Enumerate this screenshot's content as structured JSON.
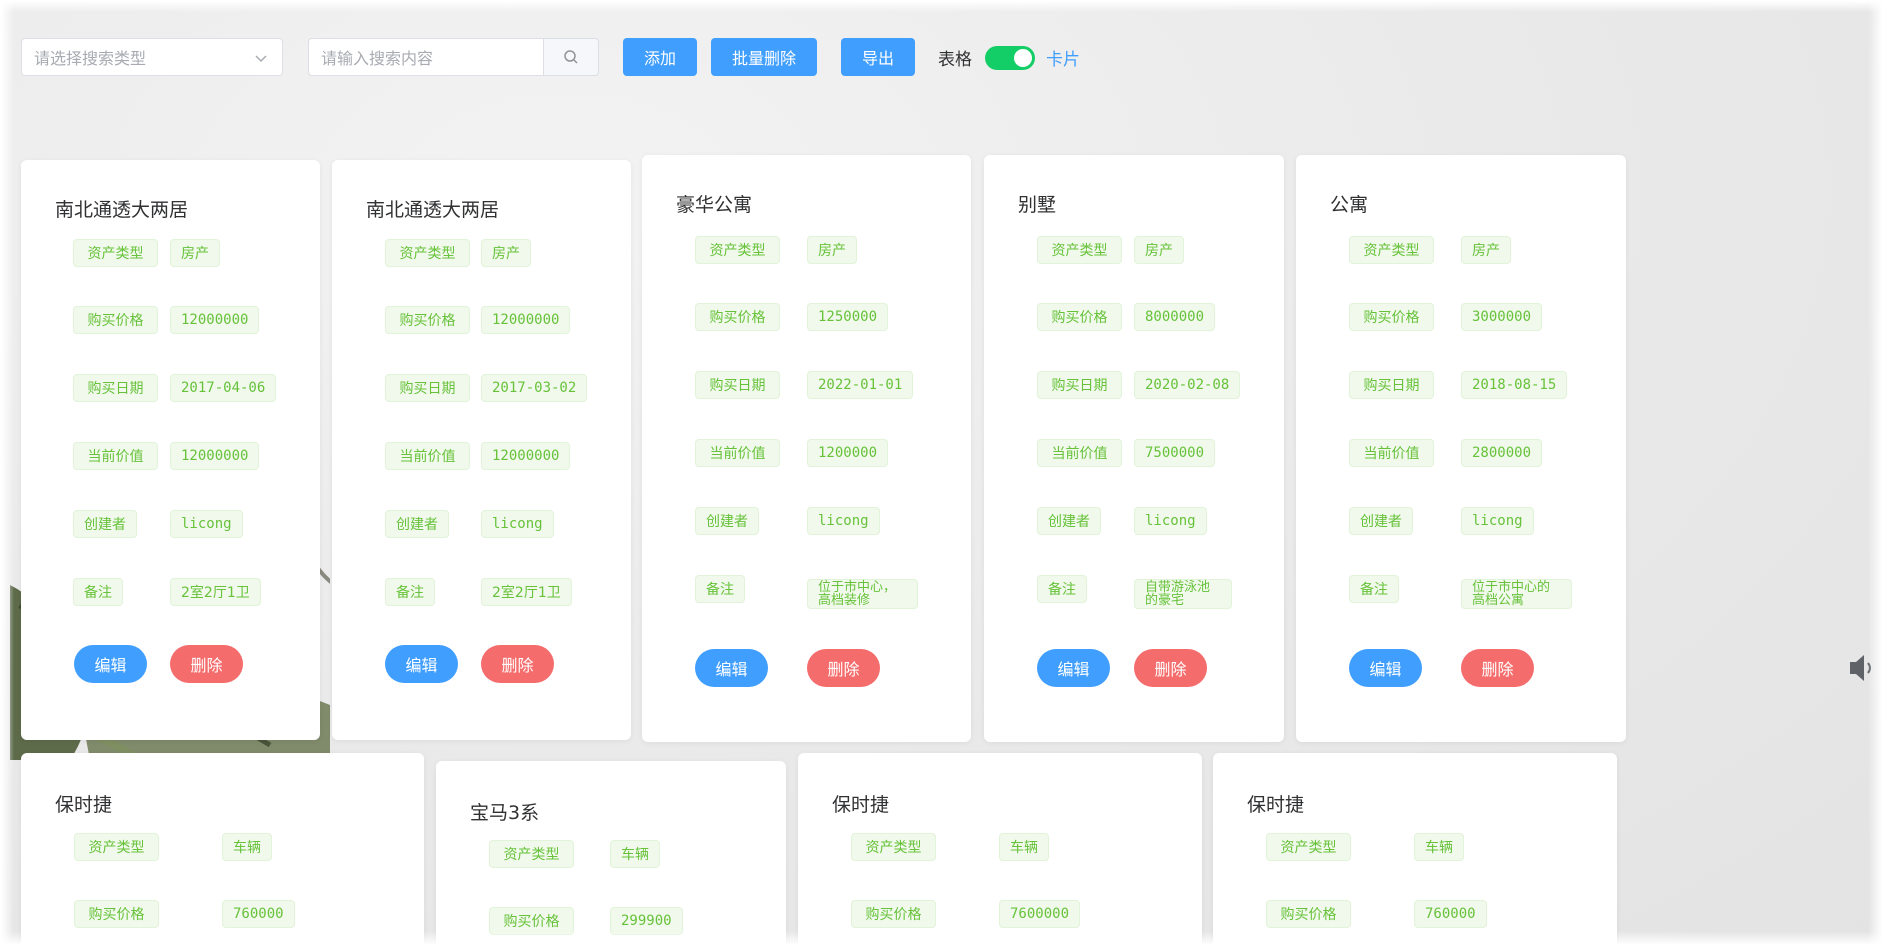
{
  "toolbar": {
    "search_type_placeholder": "请选择搜索类型",
    "search_placeholder": "请输入搜索内容",
    "add_label": "添加",
    "batch_delete_label": "批量删除",
    "export_label": "导出",
    "view_table_label": "表格",
    "view_card_label": "卡片",
    "view_mode": "card"
  },
  "colors": {
    "primary": "#409eff",
    "danger": "#f56c6c",
    "success": "#13ce66",
    "tag_text": "#67c23a",
    "tag_bg": "#f0f9eb"
  },
  "cards": [
    {
      "title": "南北通透大两居",
      "fields": [
        {
          "label": "资产类型",
          "value": "房产"
        },
        {
          "label": "购买价格",
          "value": "12000000"
        },
        {
          "label": "购买日期",
          "value": "2017-04-06"
        },
        {
          "label": "当前价值",
          "value": "12000000"
        },
        {
          "label": "创建者",
          "value": "licong"
        },
        {
          "label": "备注",
          "value": "2室2厅1卫"
        }
      ],
      "edit_label": "编辑",
      "delete_label": "删除"
    },
    {
      "title": "南北通透大两居",
      "fields": [
        {
          "label": "资产类型",
          "value": "房产"
        },
        {
          "label": "购买价格",
          "value": "12000000"
        },
        {
          "label": "购买日期",
          "value": "2017-03-02"
        },
        {
          "label": "当前价值",
          "value": "12000000"
        },
        {
          "label": "创建者",
          "value": "licong"
        },
        {
          "label": "备注",
          "value": "2室2厅1卫"
        }
      ],
      "edit_label": "编辑",
      "delete_label": "删除"
    },
    {
      "title": "豪华公寓",
      "fields": [
        {
          "label": "资产类型",
          "value": "房产"
        },
        {
          "label": "购买价格",
          "value": "1250000"
        },
        {
          "label": "购买日期",
          "value": "2022-01-01"
        },
        {
          "label": "当前价值",
          "value": "1200000"
        },
        {
          "label": "创建者",
          "value": "licong"
        },
        {
          "label": "备注",
          "value": "位于市中心，高档装修"
        }
      ],
      "edit_label": "编辑",
      "delete_label": "删除"
    },
    {
      "title": "别墅",
      "fields": [
        {
          "label": "资产类型",
          "value": "房产"
        },
        {
          "label": "购买价格",
          "value": "8000000"
        },
        {
          "label": "购买日期",
          "value": "2020-02-08"
        },
        {
          "label": "当前价值",
          "value": "7500000"
        },
        {
          "label": "创建者",
          "value": "licong"
        },
        {
          "label": "备注",
          "value": "自带游泳池的豪宅"
        }
      ],
      "edit_label": "编辑",
      "delete_label": "删除"
    },
    {
      "title": "公寓",
      "fields": [
        {
          "label": "资产类型",
          "value": "房产"
        },
        {
          "label": "购买价格",
          "value": "3000000"
        },
        {
          "label": "购买日期",
          "value": "2018-08-15"
        },
        {
          "label": "当前价值",
          "value": "2800000"
        },
        {
          "label": "创建者",
          "value": "licong"
        },
        {
          "label": "备注",
          "value": "位于市中心的高档公寓"
        }
      ],
      "edit_label": "编辑",
      "delete_label": "删除"
    },
    {
      "title": "保时捷",
      "fields": [
        {
          "label": "资产类型",
          "value": "车辆"
        },
        {
          "label": "购买价格",
          "value": "760000"
        }
      ]
    },
    {
      "title": "宝马3系",
      "fields": [
        {
          "label": "资产类型",
          "value": "车辆"
        },
        {
          "label": "购买价格",
          "value": "299900"
        }
      ]
    },
    {
      "title": "保时捷",
      "fields": [
        {
          "label": "资产类型",
          "value": "车辆"
        },
        {
          "label": "购买价格",
          "value": "7600000"
        }
      ]
    },
    {
      "title": "保时捷",
      "fields": [
        {
          "label": "资产类型",
          "value": "车辆"
        },
        {
          "label": "购买价格",
          "value": "760000"
        }
      ]
    }
  ]
}
